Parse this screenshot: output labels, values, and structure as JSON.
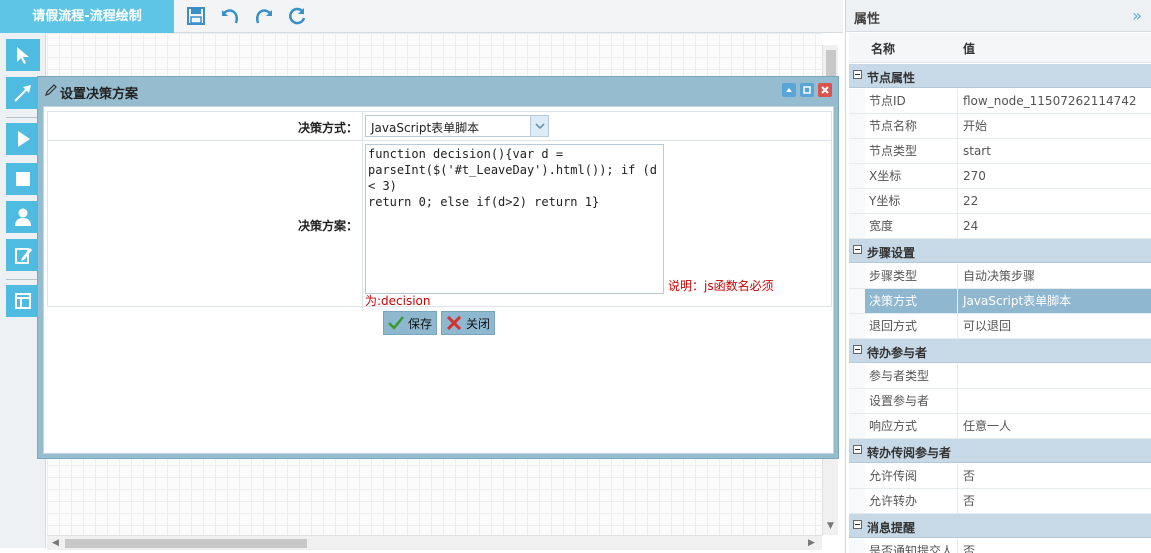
{
  "toolbar": {
    "title": "请假流程-流程绘制",
    "save_icon": "save-icon",
    "undo_icon": "undo-icon",
    "redo_icon": "redo-icon",
    "refresh_icon": "refresh-icon"
  },
  "left_tools": [
    "select-arrow-icon",
    "line-arrow-icon",
    "start-node-icon",
    "end-node-icon",
    "user-task-icon",
    "edit-task-icon",
    "layout-icon"
  ],
  "dialog": {
    "title": "设置决策方案",
    "method_label": "决策方式：",
    "method_value": "JavaScript表单脚本",
    "scheme_label": "决策方案：",
    "script": "function decision(){var d =\nparseInt($('#t_LeaveDay').html()); if (d < 3)\nreturn 0; else if(d>2) return 1}",
    "note_part1": "说明：js函数名必须",
    "note_part2": "为:decision",
    "save_label": "保存",
    "close_label": "关闭"
  },
  "properties": {
    "title": "属性",
    "col_name": "名称",
    "col_value": "值",
    "groups": [
      {
        "name": "节点属性",
        "rows": [
          {
            "k": "节点ID",
            "v": "flow_node_11507262114742"
          },
          {
            "k": "节点名称",
            "v": "开始"
          },
          {
            "k": "节点类型",
            "v": "start"
          },
          {
            "k": "X坐标",
            "v": "270"
          },
          {
            "k": "Y坐标",
            "v": "22"
          },
          {
            "k": "宽度",
            "v": "24"
          }
        ]
      },
      {
        "name": "步骤设置",
        "rows": [
          {
            "k": "步骤类型",
            "v": "自动决策步骤"
          },
          {
            "k": "决策方式",
            "v": "JavaScript表单脚本"
          },
          {
            "k": "退回方式",
            "v": "可以退回"
          }
        ]
      },
      {
        "name": "待办参与者",
        "rows": [
          {
            "k": "参与者类型",
            "v": ""
          },
          {
            "k": "设置参与者",
            "v": ""
          },
          {
            "k": "响应方式",
            "v": "任意一人"
          }
        ]
      },
      {
        "name": "转办传阅参与者",
        "rows": [
          {
            "k": "允许传阅",
            "v": "否"
          },
          {
            "k": "允许转办",
            "v": "否"
          }
        ]
      },
      {
        "name": "消息提醒",
        "rows": [
          {
            "k": "是否通知提交人",
            "v": "否"
          }
        ]
      }
    ]
  }
}
